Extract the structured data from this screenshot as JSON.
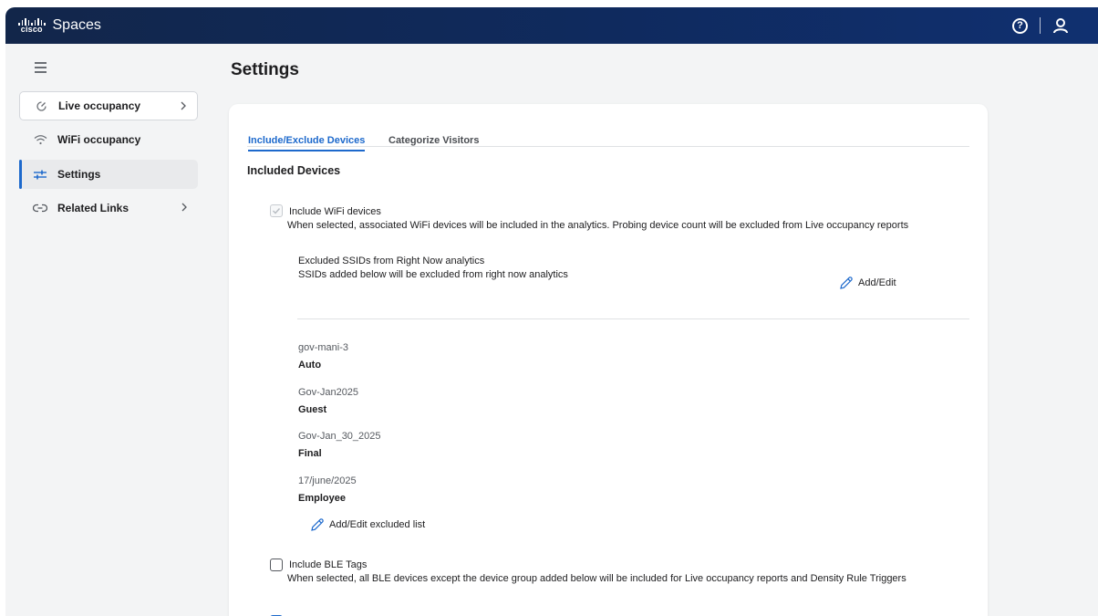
{
  "header": {
    "brand": "cisco",
    "app_name": "Spaces",
    "icons": [
      "help-icon",
      "user-icon"
    ]
  },
  "sidebar": {
    "items": [
      {
        "label": "Live occupancy",
        "icon": "occupancy-icon",
        "expandable": true
      },
      {
        "label": "WiFi occupancy",
        "icon": "wifi-icon",
        "expandable": false
      },
      {
        "label": "Settings",
        "icon": "sliders-icon",
        "expandable": false,
        "active": true
      },
      {
        "label": "Related Links",
        "icon": "link-icon",
        "expandable": true
      }
    ]
  },
  "main": {
    "title": "Settings",
    "tabs": [
      {
        "label": "Include/Exclude Devices",
        "active": true
      },
      {
        "label": "Categorize Visitors",
        "active": false
      }
    ],
    "section_title": "Included Devices",
    "wifi_option": {
      "label": "Include WiFi devices",
      "checked": true,
      "disabled": true,
      "description": "When selected, associated WiFi devices will be included in the analytics. Probing device count will be excluded from Live occupancy reports"
    },
    "excluded_ssids": {
      "title": "Excluded SSIDs from Right Now analytics",
      "subtitle": "SSIDs added below will be excluded from right now analytics",
      "add_edit_label": "Add/Edit",
      "items": [
        {
          "name": "gov-mani-3",
          "type": "Auto"
        },
        {
          "name": "Gov-Jan2025",
          "type": "Guest"
        },
        {
          "name": "Gov-Jan_30_2025",
          "type": "Final"
        },
        {
          "name": "17/june/2025",
          "type": "Employee"
        }
      ],
      "add_edit_list_label": "Add/Edit excluded list"
    },
    "ble_option": {
      "label": "Include BLE Tags",
      "checked": false,
      "description": "When selected, all BLE devices except the device group added below will be included for Live occupancy reports and Density Rule Triggers"
    },
    "rfid_option": {
      "checked": true
    }
  },
  "colors": {
    "header_bg": "#12264a",
    "accent": "#1d69cc",
    "page_bg": "#f3f4f5"
  }
}
